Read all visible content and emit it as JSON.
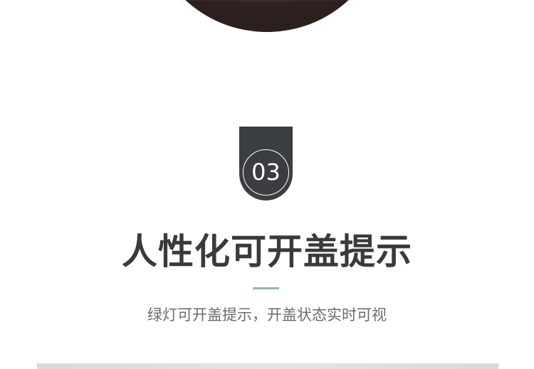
{
  "badge": {
    "number": "03"
  },
  "title": "人性化可开盖提示",
  "subtitle": "绿灯可开盖提示，开盖状态实时可视",
  "colors": {
    "badge_bg": "#3a3e41",
    "title_text": "#3a3a3a",
    "subtitle_text": "#6b6b6b",
    "divider_accent": "#8fb9ad",
    "product_dark": "#2e2220"
  }
}
